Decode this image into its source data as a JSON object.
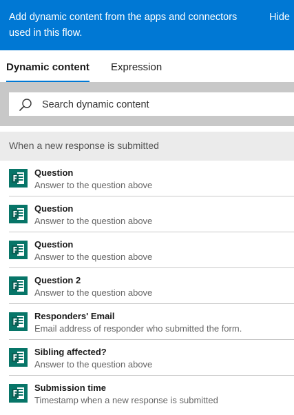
{
  "header": {
    "text": "Add dynamic content from the apps and connectors used in this flow.",
    "hide_label": "Hide"
  },
  "tabs": [
    {
      "label": "Dynamic content",
      "active": true
    },
    {
      "label": "Expression",
      "active": false
    }
  ],
  "search": {
    "placeholder": "Search dynamic content",
    "icon": "search-icon"
  },
  "section": {
    "title": "When a new response is submitted"
  },
  "items": [
    {
      "title": "Question",
      "description": "Answer to the question above",
      "icon": "microsoft-forms-icon"
    },
    {
      "title": "Question",
      "description": "Answer to the question above",
      "icon": "microsoft-forms-icon"
    },
    {
      "title": "Question",
      "description": "Answer to the question above",
      "icon": "microsoft-forms-icon"
    },
    {
      "title": "Question 2",
      "description": "Answer to the question above",
      "icon": "microsoft-forms-icon"
    },
    {
      "title": "Responders' Email",
      "description": "Email address of responder who submitted the form.",
      "icon": "microsoft-forms-icon"
    },
    {
      "title": "Sibling affected?",
      "description": "Answer to the question above",
      "icon": "microsoft-forms-icon"
    },
    {
      "title": "Submission time",
      "description": "Timestamp when a new response is submitted",
      "icon": "microsoft-forms-icon"
    }
  ],
  "colors": {
    "header_bg": "#0078d4",
    "tab_accent": "#0078d4",
    "forms_green": "#077568"
  }
}
